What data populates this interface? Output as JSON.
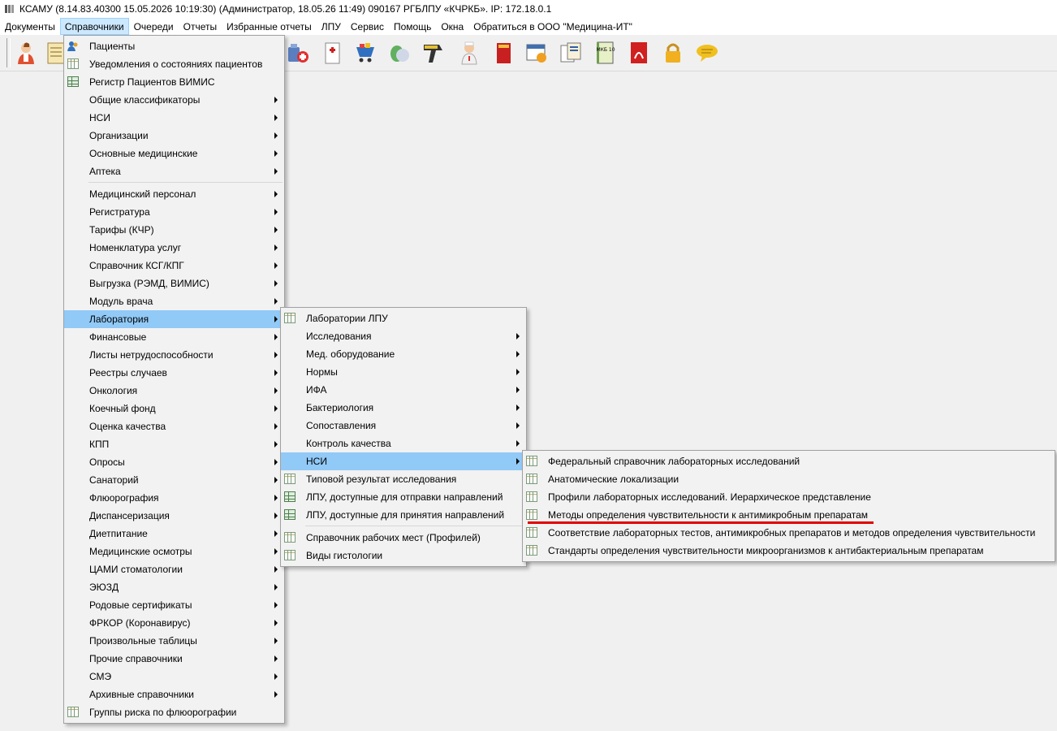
{
  "window": {
    "title": "КСАМУ (8.14.83.40300 15.05.2026 10:19:30) (Администратор, 18.05.26 11:49)  090167 РГБЛПУ «КЧРКБ». IP: 172.18.0.1"
  },
  "menubar": [
    "Документы",
    "Справочники",
    "Очереди",
    "Отчеты",
    "Избранные отчеты",
    "ЛПУ",
    "Сервис",
    "Помощь",
    "Окна",
    "Обратиться в ООО \"Медицина-ИТ\""
  ],
  "toolbar": {
    "icons": [
      "doctor-icon",
      "journal-icon",
      "medicines-icon",
      "medical-card-icon",
      "cart-icon",
      "pills-icon",
      "barcode-scanner-icon",
      "nurse-icon",
      "red-book-icon",
      "calendar-icon",
      "documents-icon",
      "mkb10-icon",
      "pdf-icon",
      "lock-icon",
      "chat-icon"
    ],
    "mkb_label": "МКБ 10"
  },
  "menu1": {
    "items": [
      "Пациенты",
      "Уведомления о состояниях пациентов",
      "Регистр Пациентов ВИМИС",
      "Общие классификаторы",
      "НСИ",
      "Организации",
      "Основные медицинские",
      "Аптека",
      "Медицинский персонал",
      "Регистратура",
      "Тарифы (КЧР)",
      "Номенклатура услуг",
      "Справочник КСГ/КПГ",
      "Выгрузка (РЭМД, ВИМИС)",
      "Модуль врача",
      "Лаборатория",
      "Финансовые",
      "Листы нетрудоспособности",
      "Реестры случаев",
      "Онкология",
      "Коечный фонд",
      "Оценка качества",
      "КПП",
      "Опросы",
      "Санаторий",
      "Флюорография",
      "Диспансеризация",
      "Диетпитание",
      "Медицинские осмотры",
      "ЦАМИ стоматологии",
      "ЭЮЗД",
      "Родовые сертификаты",
      "ФРКОР (Коронавирус)",
      "Произвольные таблицы",
      "Прочие справочники",
      "СМЭ",
      "Архивные справочники",
      "Группы риска по флюорографии"
    ]
  },
  "menu2": {
    "items": [
      "Лаборатории ЛПУ",
      "Исследования",
      "Мед. оборудование",
      "Нормы",
      "ИФА",
      "Бактериология",
      "Сопоставления",
      "Контроль качества",
      "НСИ",
      "Типовой результат исследования",
      "ЛПУ, доступные для отправки направлений",
      "ЛПУ, доступные для принятия направлений",
      "Справочник рабочих мест (Профилей)",
      "Виды гистологии"
    ]
  },
  "menu3": {
    "items": [
      "Федеральный справочник лабораторных исследований",
      "Анатомические локализации",
      "Профили лабораторных исследований. Иерархическое представление",
      "Методы определения чувствительности к антимикробным препаратам",
      "Соответствие лабораторных тестов, антимикробных препаратов и методов определения чувствительности",
      "Стандарты определения чувствительности микроорганизмов к антибактериальным препаратам"
    ]
  },
  "colors": {
    "highlight": "#91c9f7",
    "active_menu": "#cce8ff",
    "annotation_underline": "#e00000"
  }
}
